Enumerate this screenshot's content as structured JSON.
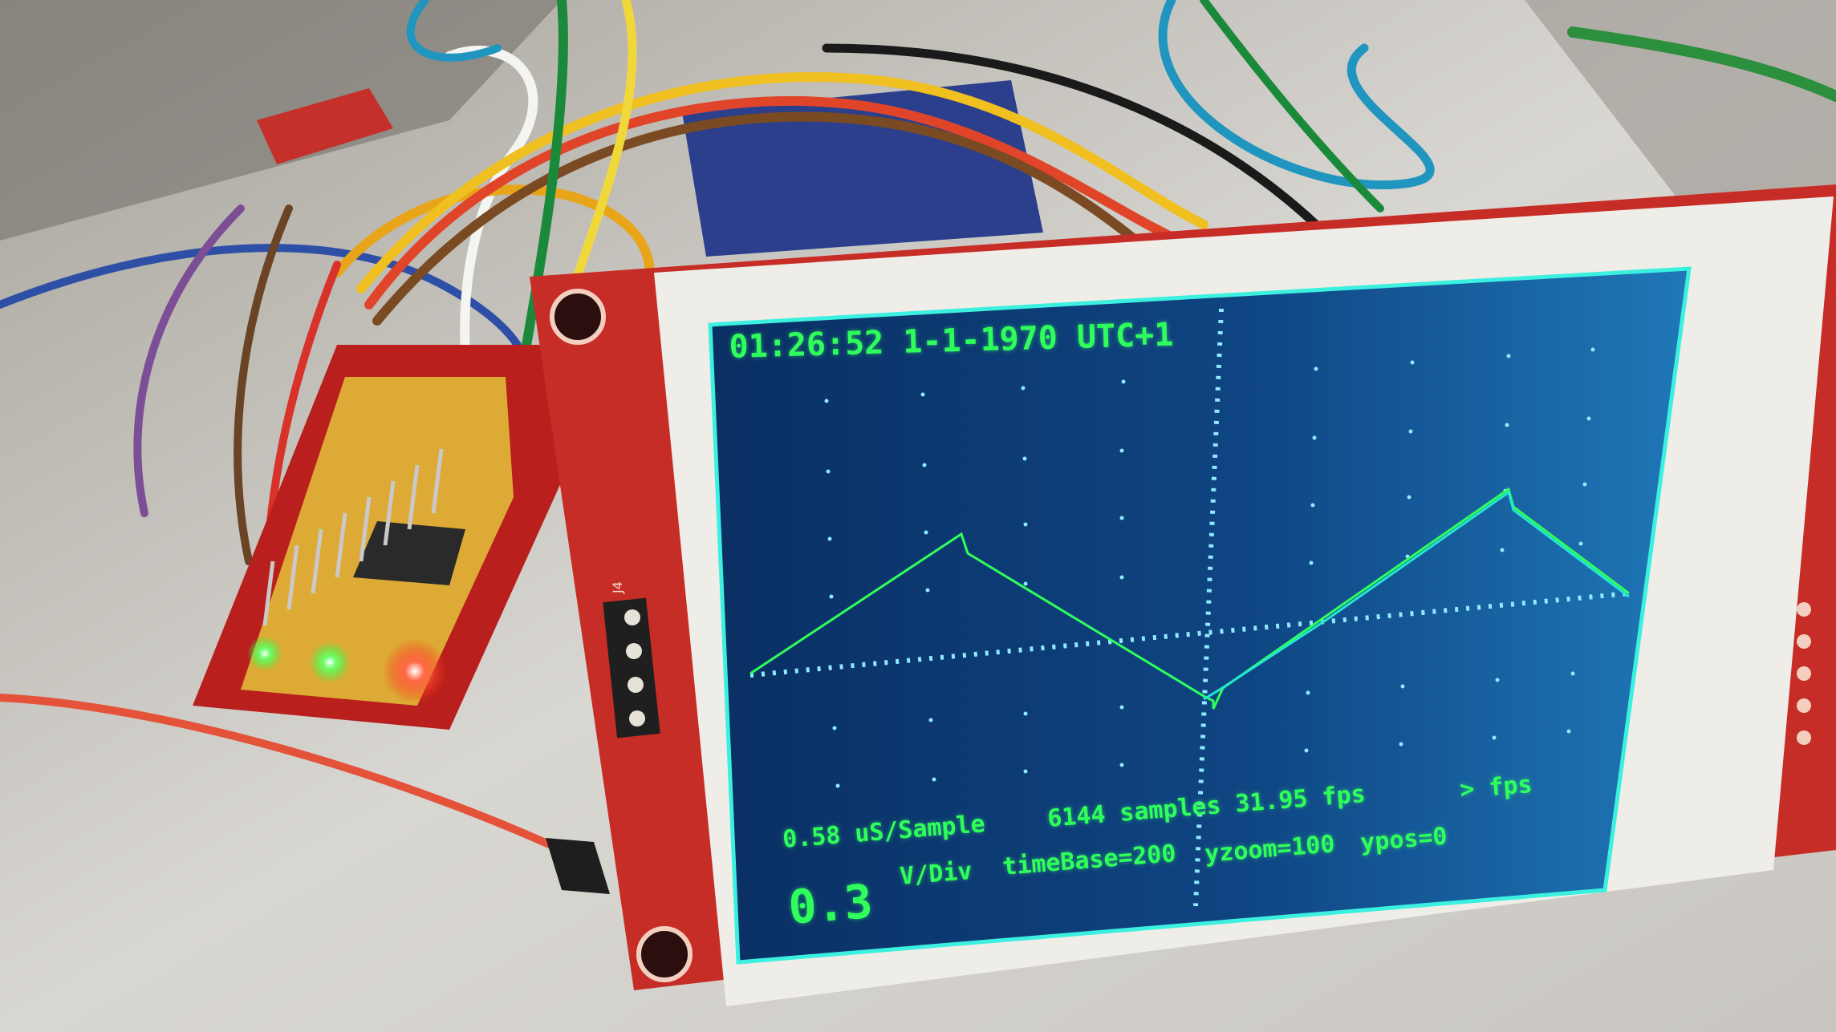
{
  "photo": {
    "subject": "oscilloscope",
    "colors": {
      "screen_background": "#0c3a72",
      "trace_green": "#2fff5a",
      "trace_cyan": "#22e6d2",
      "pcb_red": "#c42a26",
      "screen_border": "#3cf0e0"
    }
  },
  "display": {
    "clock": "01:26:52 1-1-1970 UTC+1",
    "sample_time": "0.58 uS/Sample",
    "samples_fps": "6144 samples 31.95 fps",
    "fps_marker": "> fps",
    "volts_per_div_value": "0.3",
    "volts_per_div_unit": "V/Div",
    "time_base": "timeBase=200",
    "yzoom": "yzoom=100",
    "ypos": "ypos=0"
  },
  "board": {
    "connector_label": "J4"
  }
}
